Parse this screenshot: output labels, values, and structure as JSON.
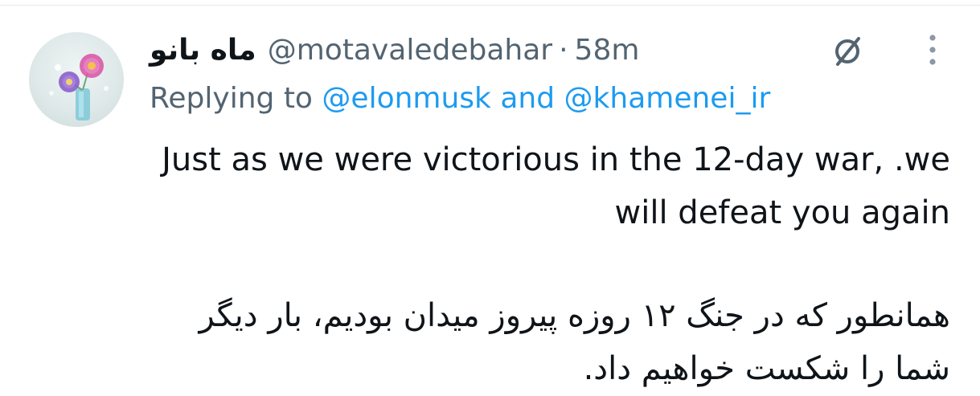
{
  "tweet": {
    "display_name": "ماه بانو",
    "handle": "@motavaledebahar",
    "separator": "·",
    "time": "58m",
    "replying_prefix": "Replying to",
    "reply_to_1": "@elonmusk",
    "reply_conjunction": "and",
    "reply_to_2": "@khamenei_ir",
    "text_en": "Just as we were victorious in the 12-day war, .we will defeat you again",
    "text_fa": "همانطور که در جنگ ۱۲ روزه پیروز میدان بودیم، بار دیگر شما را شکست خواهیم داد."
  },
  "icons": {
    "grok": "slashed-circle-icon",
    "more": "more-vertical-icon"
  },
  "colors": {
    "text_primary": "#0f1419",
    "text_secondary": "#536471",
    "mention": "#1d9bf0"
  }
}
